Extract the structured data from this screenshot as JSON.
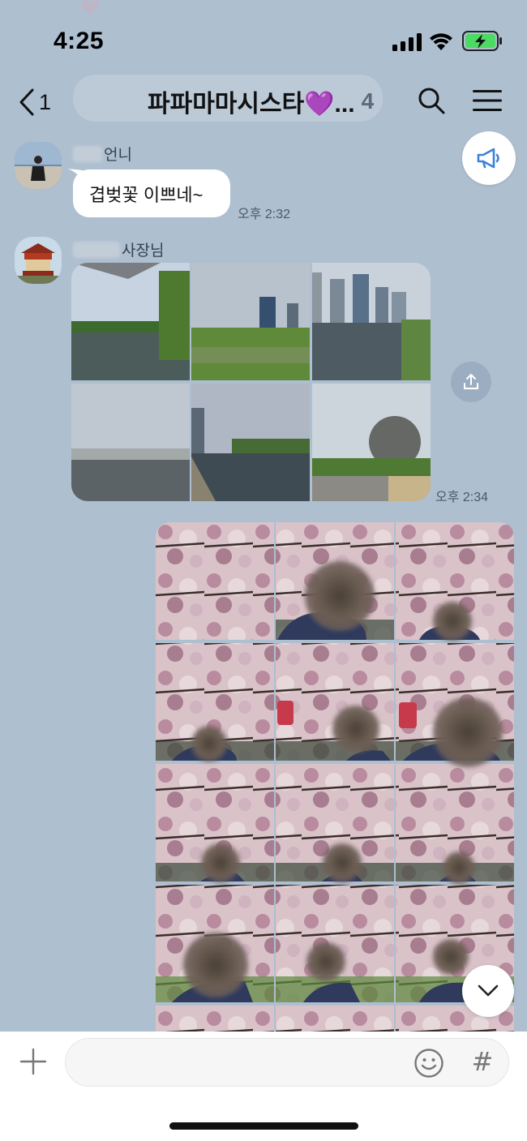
{
  "status_bar": {
    "time": "4:25",
    "battery_color": "#4cd964"
  },
  "header": {
    "back_count": "1",
    "title": "파파마마시스타💜...",
    "member_count": "4"
  },
  "messages": [
    {
      "sender": "언니",
      "text": "겹벚꽃 이쁘네~",
      "time": "오후 2:32"
    },
    {
      "sender": "사장님",
      "photo_count": 6,
      "time": "오후 2:34"
    }
  ],
  "my_photos": {
    "count_visible_rows": 4
  },
  "icons": {
    "back": "chevron-left-icon",
    "search": "search-icon",
    "menu": "hamburger-menu-icon",
    "notice": "megaphone-icon",
    "share": "share-icon",
    "scroll_down": "chevron-down-icon",
    "plus": "plus-icon",
    "emoji": "smiley-icon",
    "hash": "hashtag-icon"
  },
  "input": {
    "placeholder": "",
    "hash_glyph": "#"
  }
}
